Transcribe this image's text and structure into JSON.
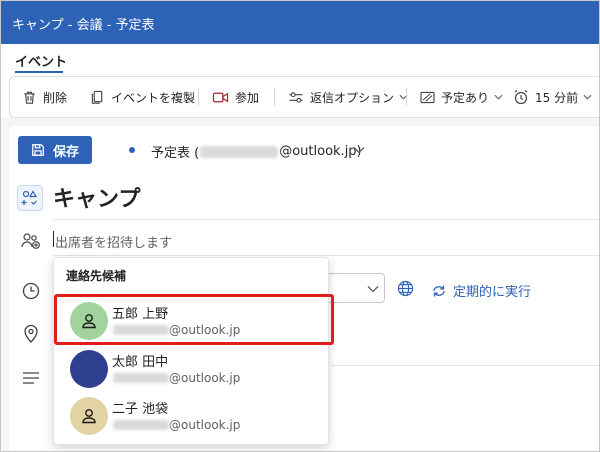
{
  "window": {
    "title": "キャンプ - 会議 - 予定表"
  },
  "tabs": [
    {
      "label": "イベント",
      "active": true
    }
  ],
  "toolbar": {
    "delete_label": "削除",
    "duplicate_label": "イベントを複製",
    "join_label": "参加",
    "response_options_label": "返信オプション",
    "busy_label": "予定あり",
    "reminder_label": "15 分前"
  },
  "form": {
    "save_label": "保存",
    "calendar_prefix": "予定表 (",
    "calendar_suffix": "@outlook.jp)",
    "event_title": "キャンプ",
    "invite_placeholder": "出席者を招待します",
    "recurrence_label": "定期的に実行"
  },
  "suggestions": {
    "header": "連絡先候補",
    "contacts": [
      {
        "name": "五郎 上野",
        "email_domain": "@outlook.jp",
        "avatar_color": "#a3d39c",
        "avatar_icon": "person-icon",
        "highlighted": true
      },
      {
        "name": "太郎 田中",
        "email_domain": "@outlook.jp",
        "avatar_color": "#2e3f8f",
        "avatar_icon": "none",
        "highlighted": false
      },
      {
        "name": "二子 池袋",
        "email_domain": "@outlook.jp",
        "avatar_color": "#e3d2a3",
        "avatar_icon": "person-icon",
        "highlighted": false
      }
    ]
  },
  "colors": {
    "accent": "#2d62b7",
    "highlight_border": "#e21b1b"
  }
}
